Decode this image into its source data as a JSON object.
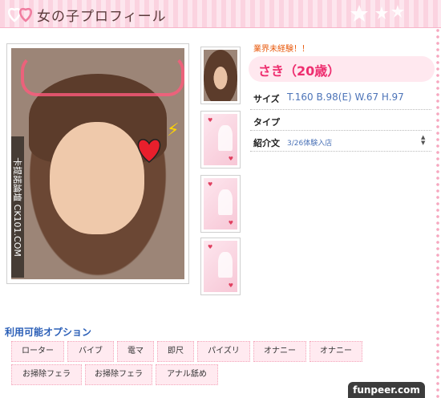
{
  "header": {
    "title": "女の子プロフィール"
  },
  "photo": {
    "watermark_vertical": "卡提諾論壇 CK101.COM"
  },
  "profile": {
    "note": "業界未経験！！",
    "name": "さき（20歳）",
    "size_label": "サイズ",
    "size_value": "T.160 B.98(E) W.67 H.97",
    "type_label": "タイプ",
    "type_value": "",
    "intro_label": "紹介文",
    "intro_value": "3/26体験入店"
  },
  "options": {
    "title": "利用可能オプション",
    "items": [
      "ローター",
      "バイブ",
      "電マ",
      "即尺",
      "パイズリ",
      "オナニー",
      "オナニー",
      "お掃除フェラ",
      "お掃除フェラ",
      "アナル舐め"
    ]
  },
  "footer": {
    "watermark": "funpeer.com"
  },
  "colors": {
    "accent_pink": "#ee2e6f",
    "link_blue": "#4d74b8",
    "note_orange": "#e8590c"
  }
}
